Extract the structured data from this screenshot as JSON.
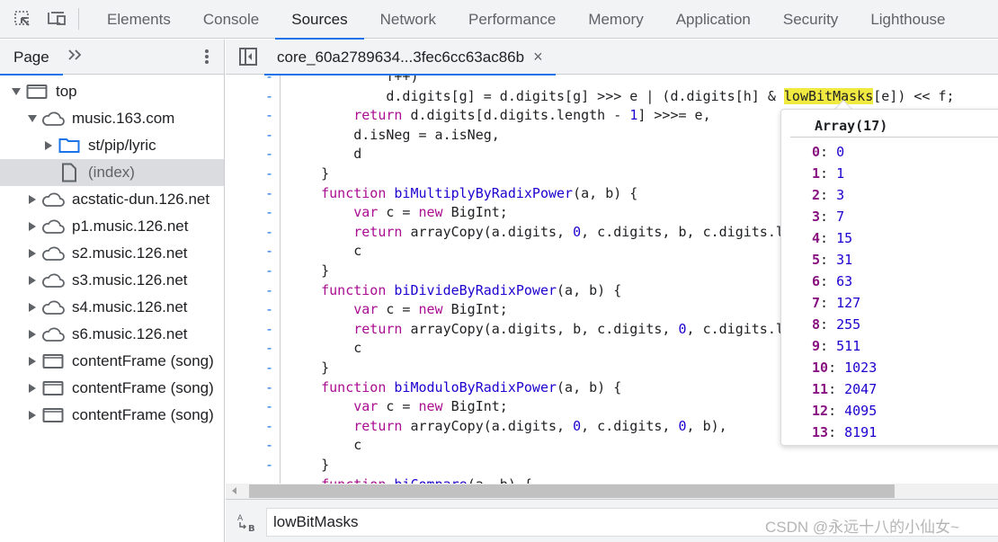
{
  "toolbar": {
    "icons": [
      "inspect-element-icon",
      "device-toolbar-icon"
    ],
    "tabs": [
      {
        "label": "Elements",
        "active": false
      },
      {
        "label": "Console",
        "active": false
      },
      {
        "label": "Sources",
        "active": true
      },
      {
        "label": "Network",
        "active": false
      },
      {
        "label": "Performance",
        "active": false
      },
      {
        "label": "Memory",
        "active": false
      },
      {
        "label": "Application",
        "active": false
      },
      {
        "label": "Security",
        "active": false
      },
      {
        "label": "Lighthouse",
        "active": false
      }
    ]
  },
  "navigator": {
    "tab_label": "Page",
    "more_tabs": "»",
    "tree": [
      {
        "label": "top",
        "icon": "frame-icon",
        "expanded": true,
        "depth": 0
      },
      {
        "label": "music.163.com",
        "icon": "cloud-icon",
        "expanded": true,
        "depth": 1
      },
      {
        "label": "st/pip/lyric",
        "icon": "folder-icon",
        "expanded": false,
        "depth": 2
      },
      {
        "label": "(index)",
        "icon": "file-icon",
        "expanded": null,
        "depth": 2,
        "selected": true
      },
      {
        "label": "acstatic-dun.126.net",
        "icon": "cloud-icon",
        "expanded": false,
        "depth": 1
      },
      {
        "label": "p1.music.126.net",
        "icon": "cloud-icon",
        "expanded": false,
        "depth": 1
      },
      {
        "label": "s2.music.126.net",
        "icon": "cloud-icon",
        "expanded": false,
        "depth": 1
      },
      {
        "label": "s3.music.126.net",
        "icon": "cloud-icon",
        "expanded": false,
        "depth": 1
      },
      {
        "label": "s4.music.126.net",
        "icon": "cloud-icon",
        "expanded": false,
        "depth": 1
      },
      {
        "label": "s6.music.126.net",
        "icon": "cloud-icon",
        "expanded": false,
        "depth": 1
      },
      {
        "label": "contentFrame (song)",
        "icon": "frame-icon",
        "expanded": false,
        "depth": 1
      },
      {
        "label": "contentFrame (song)",
        "icon": "frame-icon",
        "expanded": false,
        "depth": 1
      },
      {
        "label": "contentFrame (song)",
        "icon": "frame-icon",
        "expanded": false,
        "depth": 1
      }
    ]
  },
  "editor": {
    "file_tab": "core_60a2789634...3fec6cc63ac86b",
    "close_glyph": "×",
    "gutter_marker": "-",
    "lines": [
      [
        {
          "t": "            f++)"
        }
      ],
      [
        {
          "t": "            d.digits[g] = d.digits[g] >>> e | (d.digits[h] & "
        },
        {
          "t": "lowBitMasks",
          "c": "hl"
        },
        {
          "t": "[e]) << f;"
        }
      ],
      [
        {
          "t": "        "
        },
        {
          "t": "return",
          "c": "kw"
        },
        {
          "t": " d.digits[d.digits.length - "
        },
        {
          "t": "1",
          "c": "num"
        },
        {
          "t": "] >>>= e,"
        }
      ],
      [
        {
          "t": "        d.isNeg = a.isNeg,"
        }
      ],
      [
        {
          "t": "        d"
        }
      ],
      [
        {
          "t": "    }"
        }
      ],
      [
        {
          "t": "    "
        },
        {
          "t": "function",
          "c": "kw"
        },
        {
          "t": " "
        },
        {
          "t": "biMultiplyByRadixPower",
          "c": "fn"
        },
        {
          "t": "(a, b) {"
        }
      ],
      [
        {
          "t": "        "
        },
        {
          "t": "var",
          "c": "kw"
        },
        {
          "t": " c = "
        },
        {
          "t": "new",
          "c": "kw"
        },
        {
          "t": " BigInt;"
        }
      ],
      [
        {
          "t": "        "
        },
        {
          "t": "return",
          "c": "kw"
        },
        {
          "t": " arrayCopy(a.digits, "
        },
        {
          "t": "0",
          "c": "num"
        },
        {
          "t": ", c.digits, b, c.digits.length - b),"
        }
      ],
      [
        {
          "t": "        c"
        }
      ],
      [
        {
          "t": "    }"
        }
      ],
      [
        {
          "t": "    "
        },
        {
          "t": "function",
          "c": "kw"
        },
        {
          "t": " "
        },
        {
          "t": "biDivideByRadixPower",
          "c": "fn"
        },
        {
          "t": "(a, b) {"
        }
      ],
      [
        {
          "t": "        "
        },
        {
          "t": "var",
          "c": "kw"
        },
        {
          "t": " c = "
        },
        {
          "t": "new",
          "c": "kw"
        },
        {
          "t": " BigInt;"
        }
      ],
      [
        {
          "t": "        "
        },
        {
          "t": "return",
          "c": "kw"
        },
        {
          "t": " arrayCopy(a.digits, b, c.digits, "
        },
        {
          "t": "0",
          "c": "num"
        },
        {
          "t": ", c.digits.length - b),"
        }
      ],
      [
        {
          "t": "        c"
        }
      ],
      [
        {
          "t": "    }"
        }
      ],
      [
        {
          "t": "    "
        },
        {
          "t": "function",
          "c": "kw"
        },
        {
          "t": " "
        },
        {
          "t": "biModuloByRadixPower",
          "c": "fn"
        },
        {
          "t": "(a, b) {"
        }
      ],
      [
        {
          "t": "        "
        },
        {
          "t": "var",
          "c": "kw"
        },
        {
          "t": " c = "
        },
        {
          "t": "new",
          "c": "kw"
        },
        {
          "t": " BigInt;"
        }
      ],
      [
        {
          "t": "        "
        },
        {
          "t": "return",
          "c": "kw"
        },
        {
          "t": " arrayCopy(a.digits, "
        },
        {
          "t": "0",
          "c": "num"
        },
        {
          "t": ", c.digits, "
        },
        {
          "t": "0",
          "c": "num"
        },
        {
          "t": ", b),"
        }
      ],
      [
        {
          "t": "        c"
        }
      ],
      [
        {
          "t": "    }"
        }
      ],
      [
        {
          "t": "    "
        },
        {
          "t": "function",
          "c": "kw"
        },
        {
          "t": " "
        },
        {
          "t": "biCompare",
          "c": "fn"
        },
        {
          "t": "(a, b) {"
        }
      ]
    ]
  },
  "popover": {
    "title": "Array(17)",
    "items": [
      {
        "key": "0",
        "value": "0"
      },
      {
        "key": "1",
        "value": "1"
      },
      {
        "key": "2",
        "value": "3"
      },
      {
        "key": "3",
        "value": "7"
      },
      {
        "key": "4",
        "value": "15"
      },
      {
        "key": "5",
        "value": "31"
      },
      {
        "key": "6",
        "value": "63"
      },
      {
        "key": "7",
        "value": "127"
      },
      {
        "key": "8",
        "value": "255"
      },
      {
        "key": "9",
        "value": "511"
      },
      {
        "key": "10",
        "value": "1023"
      },
      {
        "key": "11",
        "value": "2047"
      },
      {
        "key": "12",
        "value": "4095"
      },
      {
        "key": "13",
        "value": "8191"
      }
    ]
  },
  "search": {
    "icon": "match-case-icon",
    "value": "lowBitMasks"
  },
  "watermark": "CSDN @永远十八的小仙女~",
  "colors": {
    "accent": "#1a73e8",
    "highlight": "#f0e940",
    "keyword": "#aa0d91",
    "number": "#1c00cf",
    "property_key": "#881280"
  }
}
